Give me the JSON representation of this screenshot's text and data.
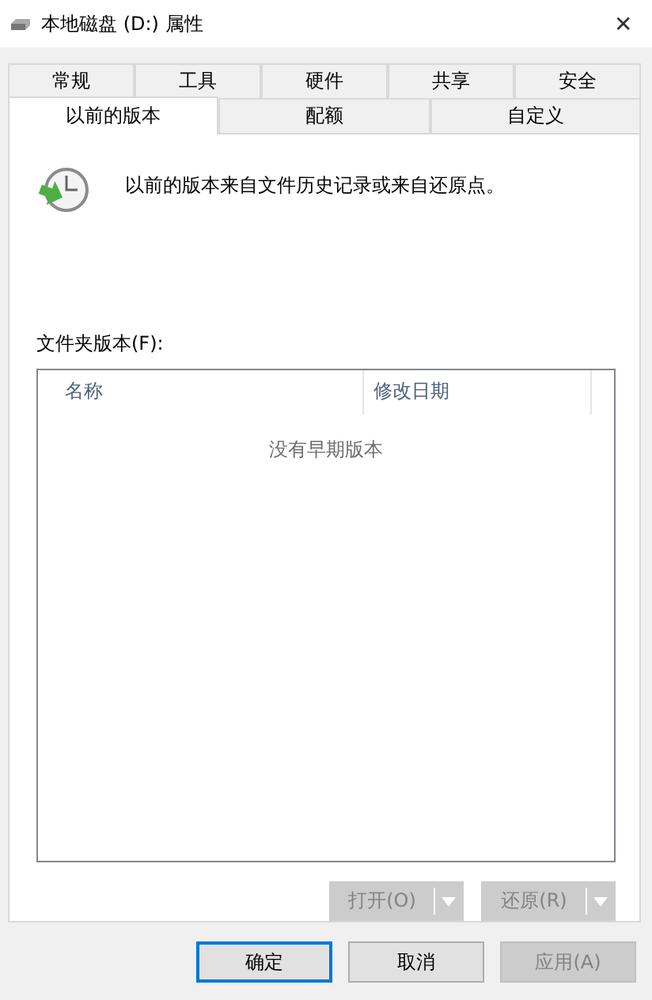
{
  "window": {
    "title": "本地磁盘 (D:) 属性",
    "close": "✕"
  },
  "tab_rows": [
    [
      {
        "label": "常规",
        "selected": false
      },
      {
        "label": "工具",
        "selected": false
      },
      {
        "label": "硬件",
        "selected": false
      },
      {
        "label": "共享",
        "selected": false
      },
      {
        "label": "安全",
        "selected": false
      }
    ],
    [
      {
        "label": "以前的版本",
        "selected": true
      },
      {
        "label": "配额",
        "selected": false
      },
      {
        "label": "自定义",
        "selected": false
      }
    ]
  ],
  "description": "以前的版本来自文件历史记录或来自还原点。",
  "list_label": "文件夹版本(F):",
  "table": {
    "columns": [
      "名称",
      "修改日期"
    ],
    "empty_text": "没有早期版本"
  },
  "actions": [
    {
      "label": "打开(O)",
      "disabled": true
    },
    {
      "label": "还原(R)",
      "disabled": true
    }
  ],
  "buttons": [
    {
      "label": "确定",
      "default": true,
      "disabled": false
    },
    {
      "label": "取消",
      "default": false,
      "disabled": false
    },
    {
      "label": "应用(A)",
      "default": false,
      "disabled": true
    }
  ]
}
